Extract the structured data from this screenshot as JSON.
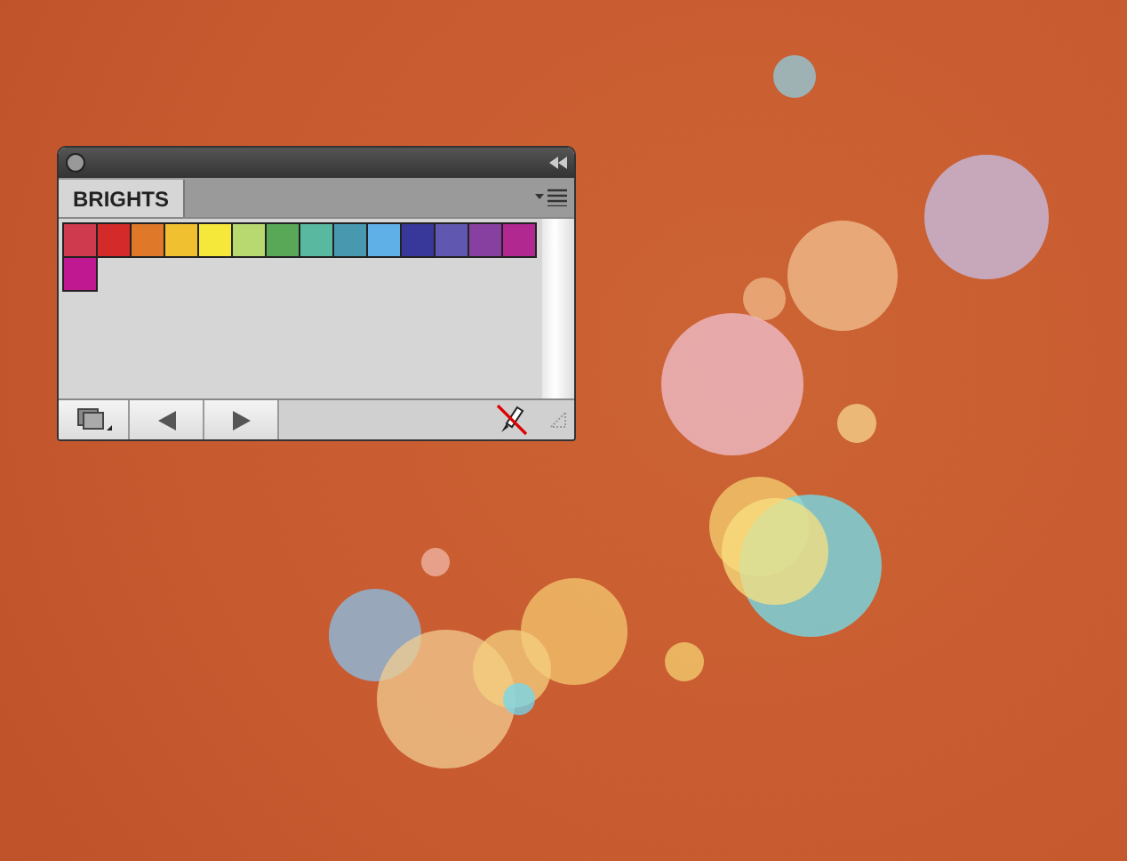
{
  "panel": {
    "tabs": [
      {
        "label": "BRIGHTS",
        "selected": true
      }
    ],
    "swatches": [
      {
        "color": "#d03a4e"
      },
      {
        "color": "#d42a2a"
      },
      {
        "color": "#e0782a"
      },
      {
        "color": "#f0c030"
      },
      {
        "color": "#f5e83a"
      },
      {
        "color": "#b8d870"
      },
      {
        "color": "#58a858"
      },
      {
        "color": "#58b8a0"
      },
      {
        "color": "#4898b0"
      },
      {
        "color": "#60b0e8"
      },
      {
        "color": "#38389a"
      },
      {
        "color": "#6058b0"
      },
      {
        "color": "#8840a0"
      },
      {
        "color": "#b02890"
      },
      {
        "color": "#c01890"
      }
    ]
  }
}
